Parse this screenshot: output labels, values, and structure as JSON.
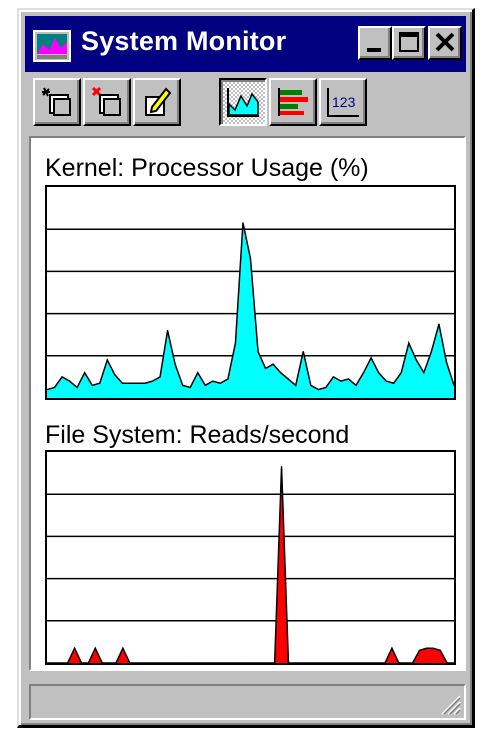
{
  "window": {
    "title": "System Monitor"
  },
  "toolbar": {
    "buttons": [
      {
        "name": "add-to-chart-button",
        "icon": "add-item-icon"
      },
      {
        "name": "remove-from-chart-button",
        "icon": "remove-item-icon"
      },
      {
        "name": "edit-chart-entry-button",
        "icon": "edit-icon"
      },
      {
        "name": "line-chart-view-button",
        "icon": "line-chart-icon",
        "pressed": true
      },
      {
        "name": "bar-chart-view-button",
        "icon": "bar-chart-icon",
        "pressed": false
      },
      {
        "name": "numeric-view-button",
        "icon": "numeric-icon",
        "label": "123",
        "pressed": false
      }
    ]
  },
  "colors": {
    "titlebar": "#000080",
    "processor_fill": "#00ffff",
    "reads_fill": "#ff0000",
    "chrome": "#c0c0c0"
  },
  "chart_data": [
    {
      "type": "area",
      "title": "Kernel: Processor Usage (%)",
      "xlabel": "",
      "ylabel": "",
      "ylim": [
        0,
        100
      ],
      "grid": true,
      "series": [
        {
          "color": "#00ffff",
          "values": [
            4,
            5,
            10,
            8,
            5,
            12,
            6,
            7,
            18,
            11,
            7,
            7,
            7,
            7,
            8,
            10,
            32,
            16,
            6,
            5,
            12,
            6,
            8,
            7,
            9,
            26,
            83,
            66,
            22,
            14,
            16,
            12,
            9,
            6,
            22,
            6,
            4,
            5,
            10,
            8,
            9,
            6,
            12,
            19,
            12,
            8,
            7,
            12,
            26,
            18,
            12,
            22,
            35,
            17,
            6
          ]
        }
      ]
    },
    {
      "type": "area",
      "title": "File System: Reads/second",
      "xlabel": "",
      "ylabel": "",
      "ylim": [
        0,
        100
      ],
      "grid": true,
      "series": [
        {
          "color": "#ff0000",
          "values": [
            0,
            0,
            0,
            0,
            7,
            0,
            0,
            7,
            0,
            0,
            0,
            7,
            0,
            0,
            0,
            0,
            0,
            0,
            0,
            0,
            0,
            0,
            0,
            0,
            0,
            0,
            0,
            0,
            0,
            0,
            0,
            0,
            0,
            0,
            93,
            0,
            0,
            0,
            0,
            0,
            0,
            0,
            0,
            0,
            0,
            0,
            0,
            0,
            0,
            0,
            7,
            0,
            0,
            0,
            6,
            7,
            7,
            6,
            0,
            0
          ]
        }
      ]
    }
  ]
}
